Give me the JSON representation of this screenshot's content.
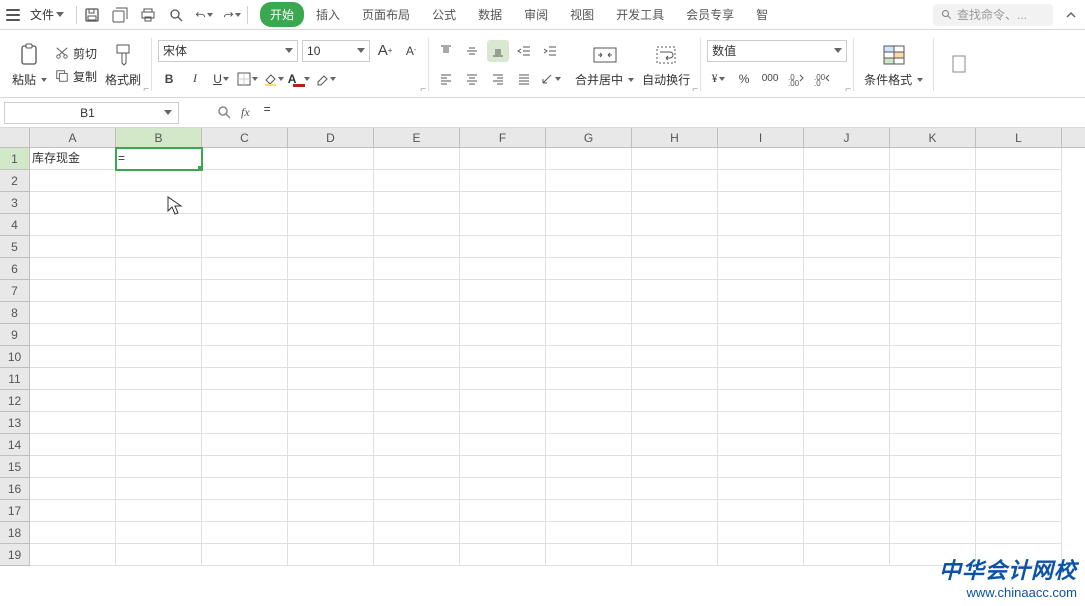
{
  "menu": {
    "file_label": "文件",
    "tabs": [
      "开始",
      "插入",
      "页面布局",
      "公式",
      "数据",
      "审阅",
      "视图",
      "开发工具",
      "会员专享",
      "智"
    ],
    "active_tab_index": 0,
    "search_placeholder": "查找命令、..."
  },
  "ribbon": {
    "paste_label": "粘贴",
    "cut_label": "剪切",
    "copy_label": "复制",
    "format_painter_label": "格式刷",
    "font_name": "宋体",
    "font_size": "10",
    "merge_label": "合并居中",
    "wrap_label": "自动换行",
    "number_format": "数值",
    "cond_fmt_label": "条件格式"
  },
  "formula_bar": {
    "cell_ref": "B1",
    "formula": "="
  },
  "grid": {
    "columns": [
      "A",
      "B",
      "C",
      "D",
      "E",
      "F",
      "G",
      "H",
      "I",
      "J",
      "K",
      "L"
    ],
    "rows": [
      "1",
      "2",
      "3",
      "4",
      "5",
      "6",
      "7",
      "8",
      "9",
      "10",
      "11",
      "12",
      "13",
      "14",
      "15",
      "16",
      "17",
      "18",
      "19"
    ],
    "active_row": 0,
    "active_col": 1,
    "cells": {
      "A1": "库存现金",
      "B1": "="
    }
  },
  "watermark": {
    "line1": "中华会计网校",
    "line2": "www.chinaacc.com"
  },
  "colors": {
    "accent_green": "#3aa84f",
    "font_red": "#b02418",
    "link_blue": "#0a53a8"
  }
}
